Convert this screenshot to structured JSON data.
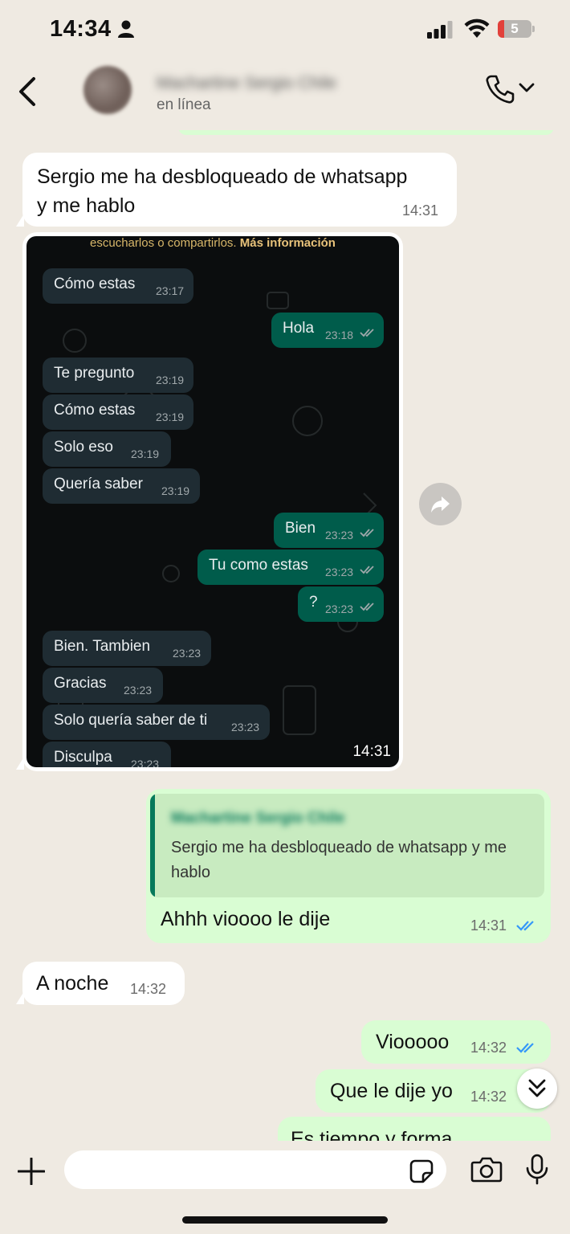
{
  "status_bar": {
    "time": "14:34",
    "battery": "5"
  },
  "header": {
    "contact_name": "Machartine Sergio Chile",
    "contact_status": "en línea"
  },
  "messages": [
    {
      "text": "Sergio me ha desbloqueado de whatsapp\ny me hablo",
      "time": "14:31"
    },
    {
      "time": "14:31"
    },
    {
      "quote_name": "Machartine Sergio Chile",
      "quote_text": "Sergio me ha desbloqueado de whatsapp y me hablo",
      "text": "Ahhh vioooo le dije",
      "time": "14:31"
    },
    {
      "text": "A noche",
      "time": "14:32"
    },
    {
      "text": "Viooooo",
      "time": "14:32"
    },
    {
      "text": "Que le dije yo",
      "time": "14:32"
    },
    {
      "text": "Es tiempo y forma"
    }
  ],
  "screenshot": {
    "info_prefix": "escucharlos o compartirlos.",
    "info_link": "Más información",
    "messages": [
      {
        "text": "Cómo estas",
        "time": "23:17"
      },
      {
        "text": "Hola",
        "time": "23:18"
      },
      {
        "text": "Te pregunto",
        "time": "23:19"
      },
      {
        "text": "Cómo estas",
        "time": "23:19"
      },
      {
        "text": "Solo eso",
        "time": "23:19"
      },
      {
        "text": "Quería saber",
        "time": "23:19"
      },
      {
        "text": "Bien",
        "time": "23:23"
      },
      {
        "text": "Tu como estas",
        "time": "23:23"
      },
      {
        "text": "?",
        "time": "23:23"
      },
      {
        "text": "Bien. Tambien",
        "time": "23:23"
      },
      {
        "text": "Gracias",
        "time": "23:23"
      },
      {
        "text": "Solo quería saber de ti",
        "time": "23:23"
      },
      {
        "text": "Disculpa",
        "time": "23:23"
      }
    ]
  },
  "composer": {
    "placeholder": ""
  },
  "colors": {
    "chat_bg": "#efeae2",
    "outgoing_bubble": "#d9fdd3",
    "incoming_bubble": "#ffffff",
    "read_tick": "#3497f9",
    "quote_accent": "#06795b"
  },
  "icons": [
    "person-icon",
    "signal-icon",
    "wifi-icon",
    "back-icon",
    "phone-icon",
    "chevron-down-icon",
    "forward-icon",
    "double-chevron-down-icon",
    "plus-icon",
    "sticker-icon",
    "camera-icon",
    "microphone-icon",
    "double-check-icon"
  ]
}
